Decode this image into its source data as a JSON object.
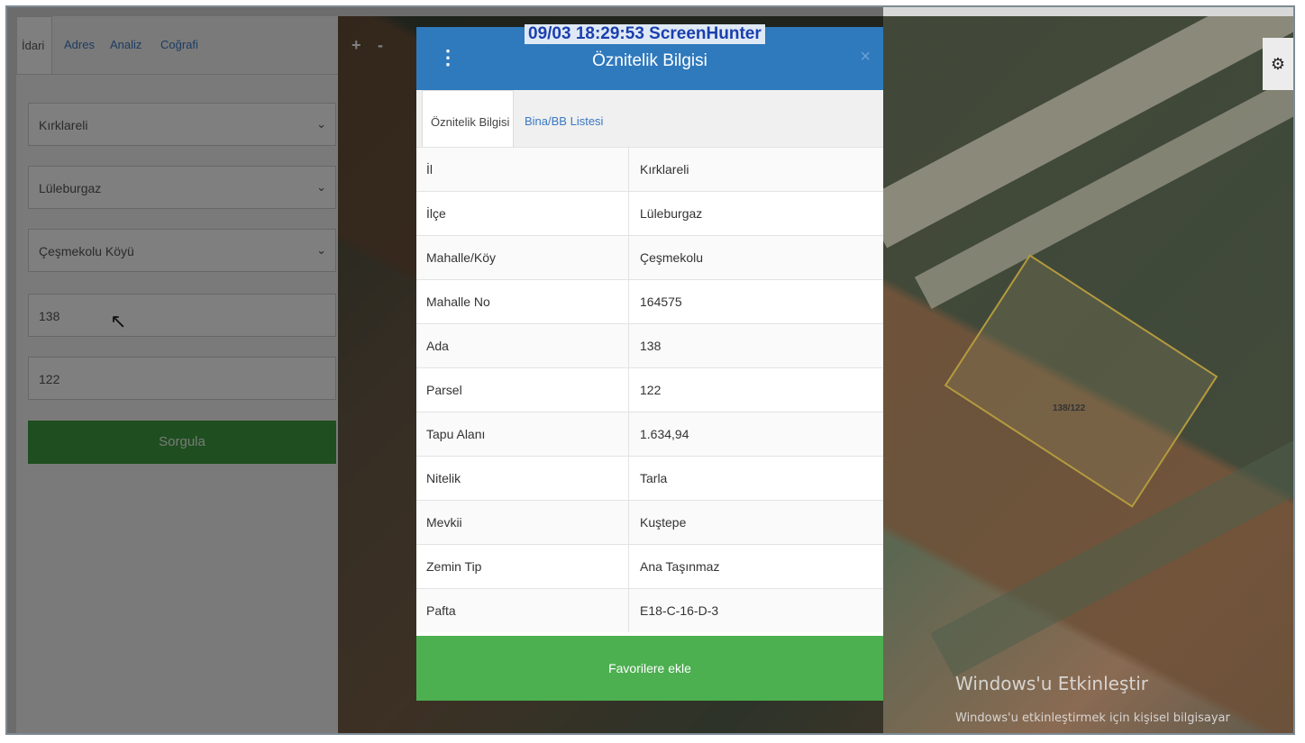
{
  "left_panel": {
    "tabs": [
      {
        "label": "İdari"
      },
      {
        "label": "Adres"
      },
      {
        "label": "Analiz"
      },
      {
        "label": "Coğrafi"
      }
    ],
    "province_select": "Kırklareli",
    "district_select": "Lüleburgaz",
    "neighborhood_select": "Çeşmekolu Köyü",
    "block_input": "138",
    "parcel_input": "122",
    "query_button": "Sorgula"
  },
  "map": {
    "zoom_in": "+",
    "zoom_out": "-",
    "parcel_label": "138/122",
    "settings_icon": "gear-icon"
  },
  "screenhunter_stamp": "09/03  18:29:53  ScreenHunter",
  "popup": {
    "title": "Öznitelik Bilgisi",
    "close": "×",
    "tabs": [
      {
        "label": "Öznitelik Bilgisi"
      },
      {
        "label": "Bina/BB Listesi"
      }
    ],
    "rows": [
      {
        "key": "İl",
        "value": "Kırklareli"
      },
      {
        "key": "İlçe",
        "value": "Lüleburgaz"
      },
      {
        "key": "Mahalle/Köy",
        "value": "Çeşmekolu"
      },
      {
        "key": "Mahalle No",
        "value": "164575"
      },
      {
        "key": "Ada",
        "value": "138"
      },
      {
        "key": "Parsel",
        "value": "122"
      },
      {
        "key": "Tapu Alanı",
        "value": "1.634,94"
      },
      {
        "key": "Nitelik",
        "value": "Tarla"
      },
      {
        "key": "Mevkii",
        "value": "Kuştepe"
      },
      {
        "key": "Zemin Tip",
        "value": "Ana Taşınmaz"
      },
      {
        "key": "Pafta",
        "value": "E18-C-16-D-3"
      }
    ],
    "favorite_button": "Favorilere ekle"
  },
  "watermark": {
    "title": "Windows'u Etkinleştir",
    "subtitle": "Windows'u etkinleştirmek için kişisel bilgisayar"
  },
  "colors": {
    "header_blue": "#2f79bd",
    "query_green": "#3f9c41",
    "favorite_green": "#4caf50"
  }
}
